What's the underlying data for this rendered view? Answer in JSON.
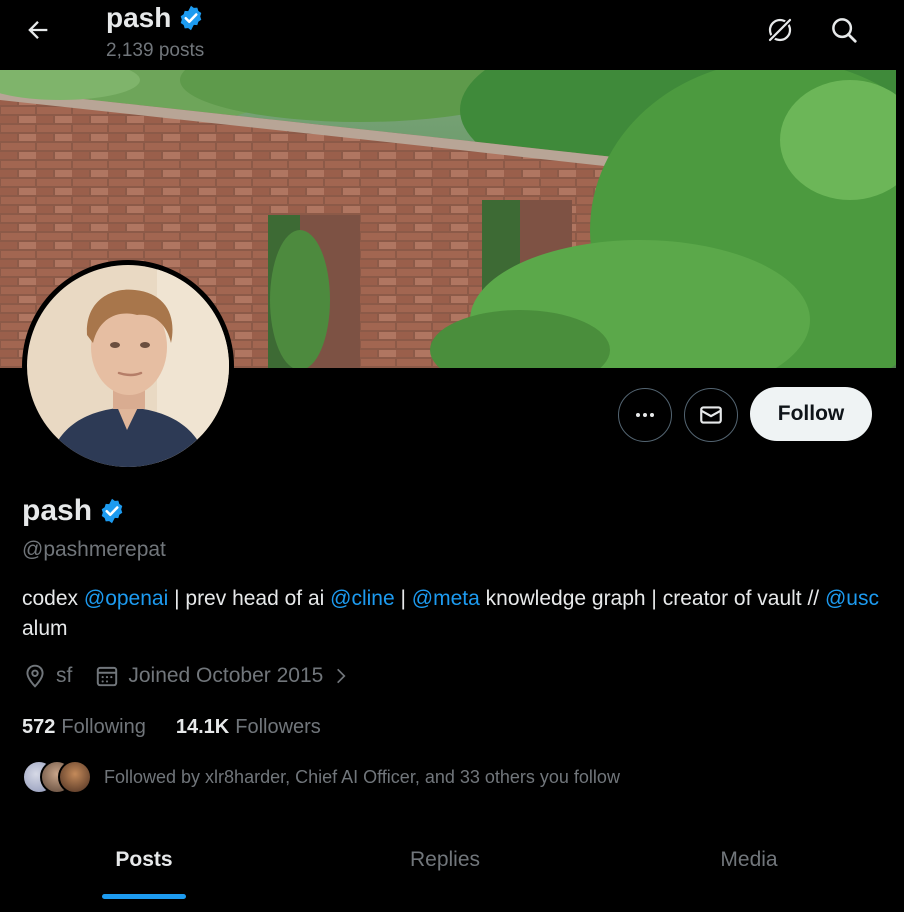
{
  "header": {
    "name": "pash",
    "posts_count": "2,139 posts"
  },
  "profile": {
    "name": "pash",
    "handle": "@pashmerepat",
    "bio": {
      "t1": "codex ",
      "m1": "@openai",
      "t2": " | prev head of ai ",
      "m2": "@cline",
      "t3": " | ",
      "m3": "@meta",
      "t4": " knowledge graph | creator of vault // ",
      "m4": "@usc",
      "t5": " alum"
    },
    "location": "sf",
    "joined": "Joined October 2015",
    "following_count": "572",
    "following_label": "Following",
    "followers_count": "14.1K",
    "followers_label": "Followers",
    "followed_by": "Followed by xlr8harder, Chief AI Officer, and 33 others you follow"
  },
  "actions": {
    "follow_label": "Follow"
  },
  "tabs": [
    {
      "label": "Posts"
    },
    {
      "label": "Replies"
    },
    {
      "label": "Media"
    }
  ],
  "icons": {
    "back": "back-arrow-icon",
    "grok": "grok-icon",
    "search": "search-icon",
    "more": "more-icon",
    "message": "mail-icon",
    "verified": "verified-badge-icon",
    "location": "location-pin-icon",
    "calendar": "calendar-icon"
  },
  "colors": {
    "accent": "#1d9bf0",
    "background": "#000000",
    "text": "#e7e9ea",
    "muted": "#71767b"
  }
}
